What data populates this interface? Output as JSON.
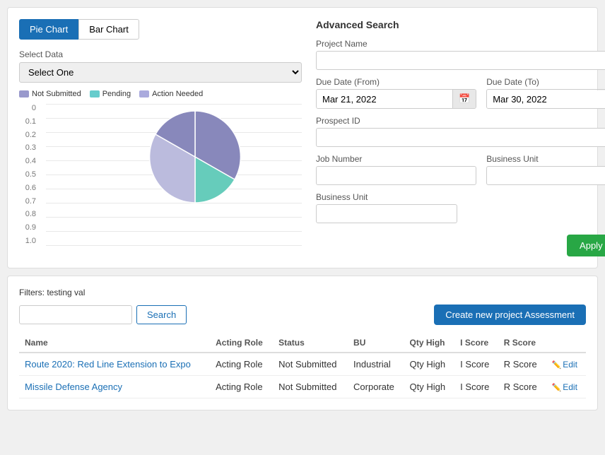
{
  "tabs": [
    {
      "id": "pie-chart",
      "label": "Pie Chart",
      "active": true
    },
    {
      "id": "bar-chart",
      "label": "Bar Chart",
      "active": false
    }
  ],
  "chart": {
    "select_label": "Select Data",
    "select_placeholder": "Select One",
    "y_axis": [
      "1.0",
      "0.9",
      "0.8",
      "0.7",
      "0.6",
      "0.5",
      "0.4",
      "0.3",
      "0.2",
      "0.1",
      "0"
    ],
    "legend": [
      {
        "id": "not-submitted",
        "label": "Not Submitted",
        "color": "#9999cc"
      },
      {
        "id": "pending",
        "label": "Pending",
        "color": "#66cccc"
      },
      {
        "id": "action-needed",
        "label": "Action Needed",
        "color": "#aaaadd"
      }
    ]
  },
  "advanced_search": {
    "title": "Advanced Search",
    "fields": {
      "project_name": {
        "label": "Project Name",
        "value": "",
        "placeholder": ""
      },
      "due_date_from": {
        "label": "Due Date (From)",
        "value": "Mar 21, 2022"
      },
      "due_date_to": {
        "label": "Due Date (To)",
        "value": "Mar 30, 2022"
      },
      "prospect_id": {
        "label": "Prospect ID",
        "value": "",
        "placeholder": ""
      },
      "job_number": {
        "label": "Job Number",
        "value": "",
        "placeholder": ""
      },
      "business_unit_top": {
        "label": "Business Unit",
        "value": "",
        "placeholder": ""
      },
      "business_unit_bottom": {
        "label": "Business Unit",
        "value": "",
        "placeholder": ""
      }
    },
    "apply_button": "Apply Search"
  },
  "results": {
    "filters_label": "Filters:",
    "filters_value": "testing val",
    "search_placeholder": "",
    "search_button": "Search",
    "create_button": "Create new project Assessment",
    "columns": [
      "Name",
      "Acting Role",
      "Status",
      "BU",
      "Qty High",
      "I Score",
      "R Score",
      ""
    ],
    "rows": [
      {
        "name": "Route 2020: Red Line Extension to Expo",
        "acting_role": "Acting Role",
        "status": "Not Submitted",
        "bu": "Industrial",
        "qty_high": "Qty High",
        "i_score": "I Score",
        "r_score": "R Score",
        "edit": "Edit"
      },
      {
        "name": "Missile Defense Agency",
        "acting_role": "Acting Role",
        "status": "Not Submitted",
        "bu": "Corporate",
        "qty_high": "Qty High",
        "i_score": "I Score",
        "r_score": "R Score",
        "edit": "Edit"
      }
    ]
  },
  "colors": {
    "active_tab": "#1a6fb5",
    "create_btn": "#1a6fb5",
    "apply_btn": "#28a745",
    "link": "#1a6fb5",
    "pie_blue": "#8888bb",
    "pie_teal": "#66ccbb",
    "pie_lavender": "#bbbbdd"
  }
}
